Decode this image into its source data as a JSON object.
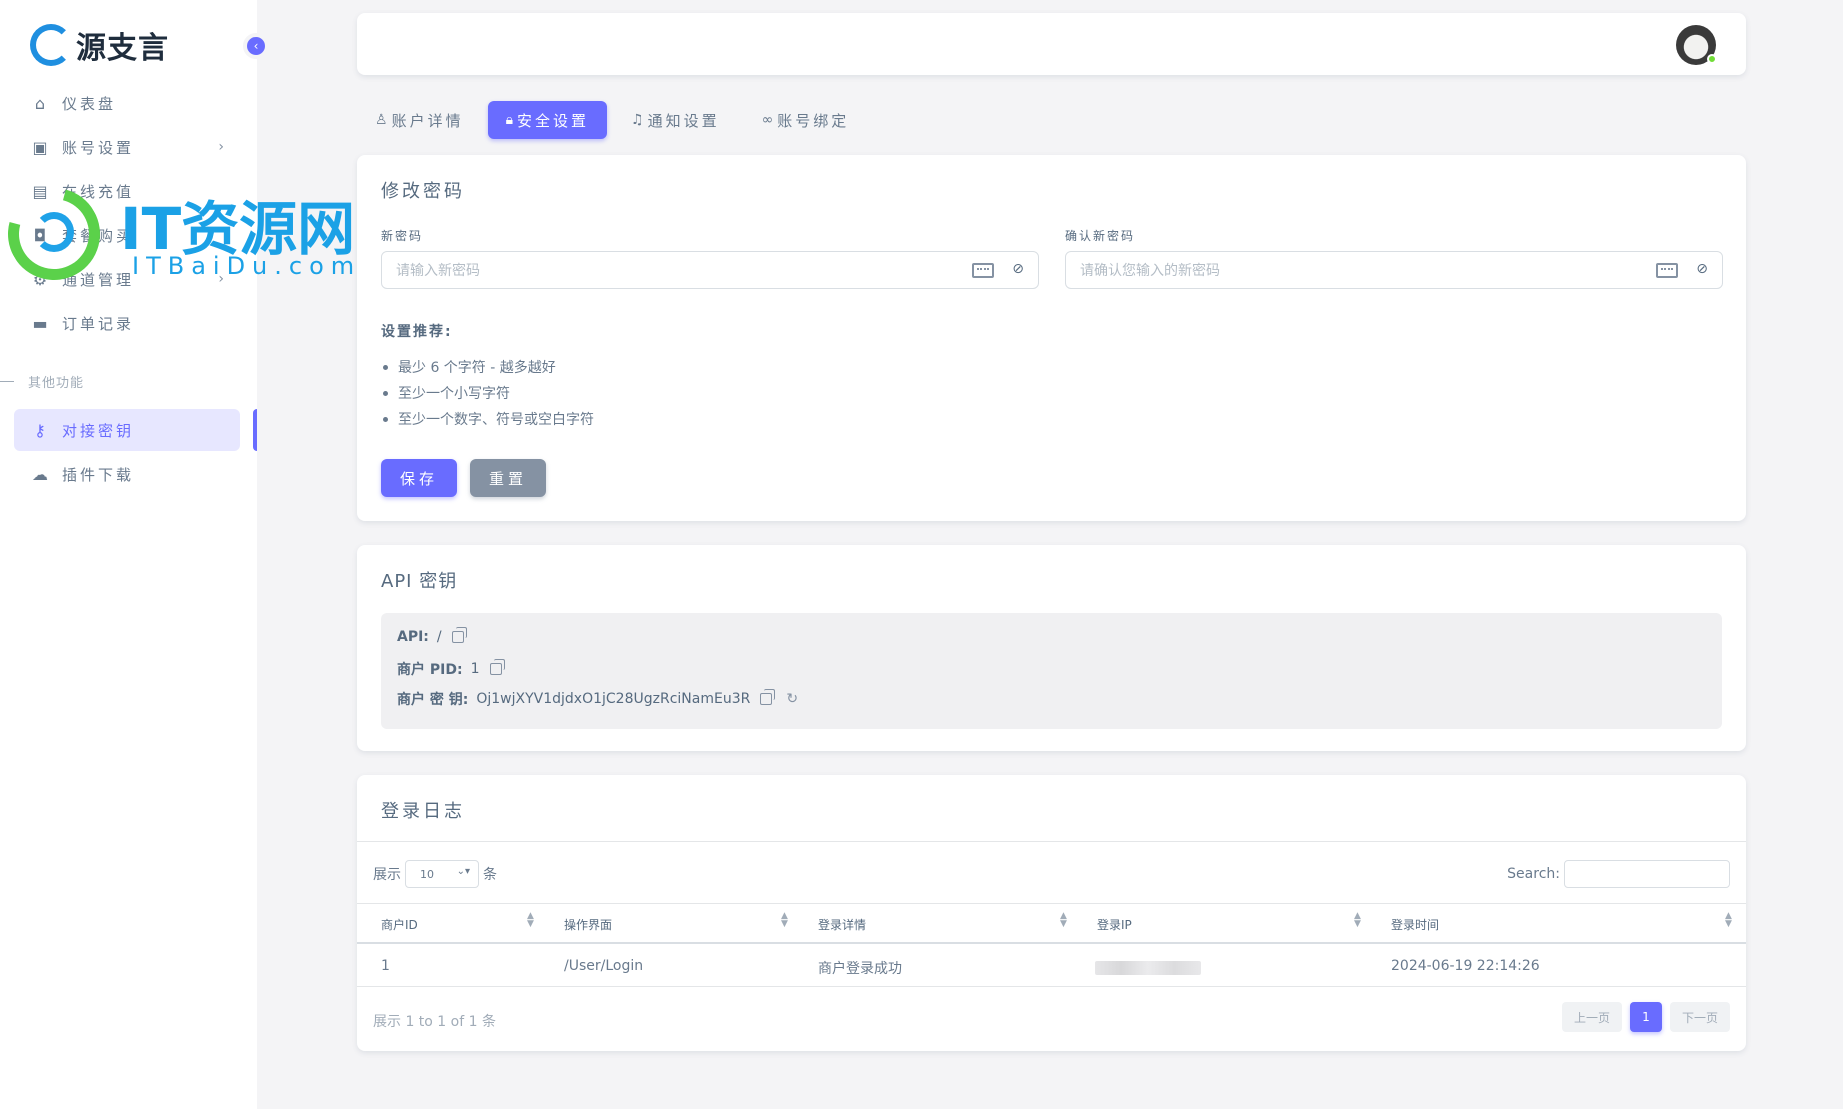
{
  "brand": {
    "logo_text": "源支言"
  },
  "watermark": {
    "title": "IT资源网",
    "subtitle": "ITBaiDu.com"
  },
  "sidebar": {
    "items": [
      {
        "label": "仪表盘",
        "icon": "home-icon"
      },
      {
        "label": "账号设置",
        "icon": "user-card-icon"
      },
      {
        "label": "在线充值",
        "icon": "wallet-icon"
      },
      {
        "label": "套餐购买",
        "icon": "shopping-bag-icon"
      },
      {
        "label": "通道管理",
        "icon": "gear-icon"
      },
      {
        "label": "订单记录",
        "icon": "wallet-icon"
      }
    ],
    "section_header": "其他功能",
    "extra_items": [
      {
        "label": "对接密钥",
        "icon": "key-icon",
        "active": true
      },
      {
        "label": "插件下载",
        "icon": "cloud-download-icon"
      }
    ]
  },
  "tabs": [
    {
      "label": "账户详情",
      "icon": "user-icon"
    },
    {
      "label": "安全设置",
      "icon": "lock-icon",
      "active": true
    },
    {
      "label": "通知设置",
      "icon": "bell-icon"
    },
    {
      "label": "账号绑定",
      "icon": "link-icon"
    }
  ],
  "password_card": {
    "title": "修改密码",
    "new_password_label": "新密码",
    "new_password_placeholder": "请输入新密码",
    "confirm_label": "确认新密码",
    "confirm_placeholder": "请确认您输入的新密码",
    "recommend_title": "设置推荐:",
    "recommendations": [
      "最少 6 个字符 - 越多越好",
      "至少一个小写字符",
      "至少一个数字、符号或空白字符"
    ],
    "save_label": "保存",
    "reset_label": "重置"
  },
  "api_card": {
    "title": "API 密钥",
    "api_label": "API:",
    "api_value": "/",
    "pid_label": "商户 PID:",
    "pid_value": "1",
    "key_label": "商户 密 钥:",
    "key_value": "Oj1wjXYV1djdxO1jC28UgzRciNamEu3R"
  },
  "log_card": {
    "title": "登录日志",
    "length_prefix": "展示",
    "length_value": "10",
    "length_suffix": "条",
    "search_label": "Search:",
    "columns": [
      "商户ID",
      "操作界面",
      "登录详情",
      "登录IP",
      "登录时间"
    ],
    "rows": [
      {
        "id": "1",
        "page": "/User/Login",
        "detail": "商户登录成功",
        "time": "2024-06-19 22:14:26"
      }
    ],
    "info": "展示 1 to 1 of 1 条",
    "prev": "上一页",
    "current_page": "1",
    "next": "下一页"
  },
  "colors": {
    "primary": "#696cff",
    "secondary": "#8592a3",
    "background": "#f4f4f6",
    "online": "#71dd37"
  }
}
